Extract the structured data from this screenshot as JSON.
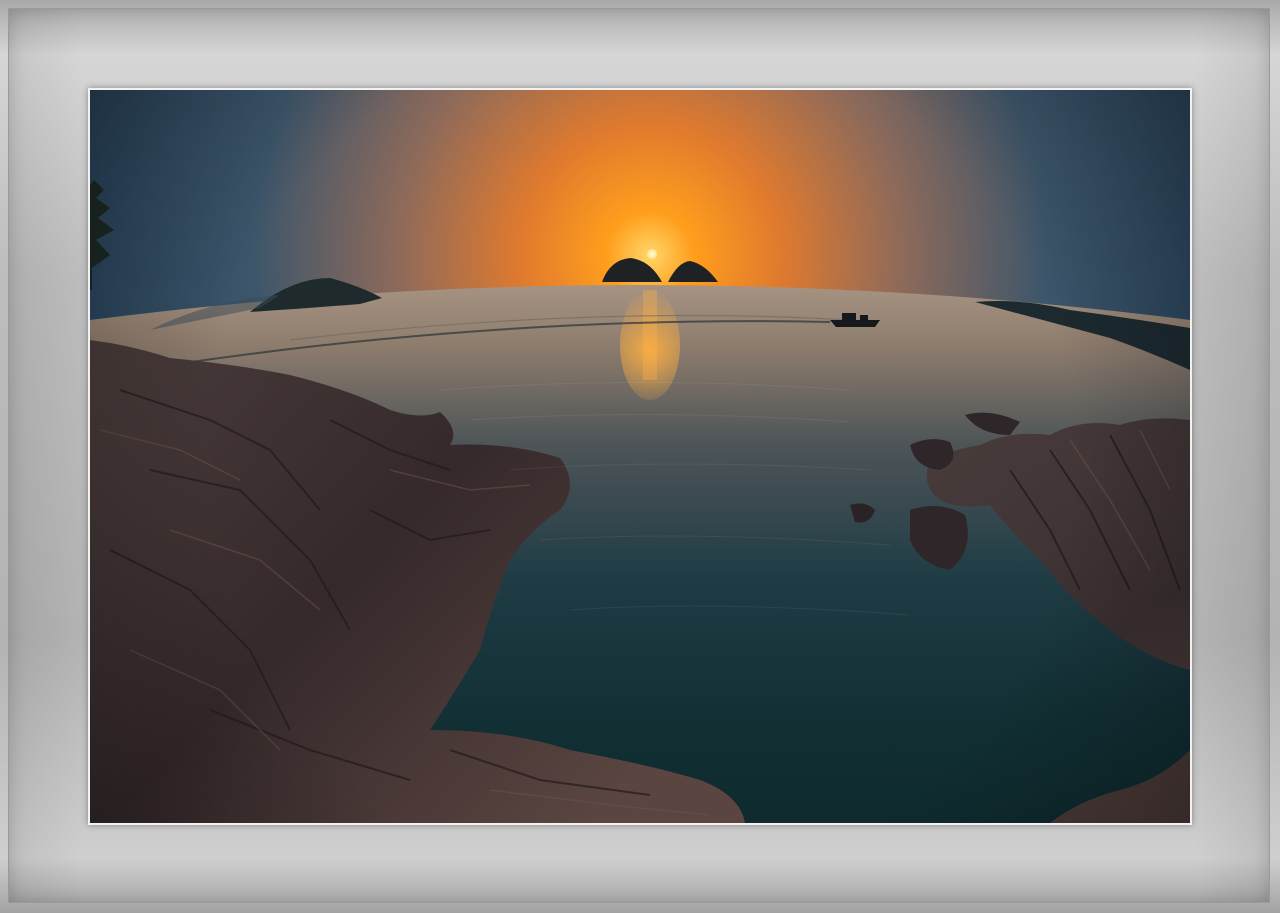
{
  "photo": {
    "subject": "sunset-over-sea-with-rocky-shore",
    "colors": {
      "sky_top": "#1f3b55",
      "sky_glow": "#f28a1a",
      "sun": "#ffe27a",
      "water_far": "#9a8a7c",
      "water_near": "#102a33",
      "rock": "#3b3233",
      "frame": "#b8b8b8",
      "mat": "#f2f2f2"
    }
  }
}
